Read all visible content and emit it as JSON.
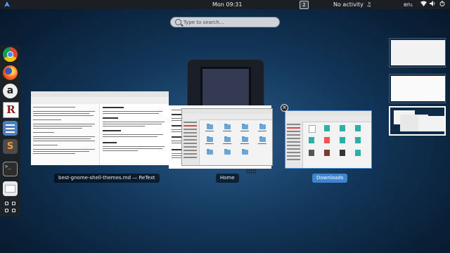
{
  "topbar": {
    "clock": "Mon 09:31",
    "workspace_indicator": "2",
    "activity": "No activity",
    "language": "en₁",
    "icons": [
      "activities-icon",
      "music-icon",
      "wifi-icon",
      "volume-icon",
      "power-icon"
    ]
  },
  "search": {
    "placeholder": "Type to search..."
  },
  "dash": {
    "apps": [
      "chrome-icon",
      "firefox-icon",
      "atom-icon",
      "retext-icon",
      "settings-icon",
      "sublime-text-icon",
      "terminal-icon",
      "files-icon",
      "app-grid-icon"
    ],
    "atom_glyph": "a",
    "retext_glyph": "R",
    "sublime_glyph": "S",
    "terminal_glyph": ">_"
  },
  "windows": [
    {
      "label": "best-gnome-shell-themes.md — ReText"
    },
    {
      "label": "Home"
    },
    {
      "label": "Downloads"
    }
  ],
  "close_glyph": "×",
  "colors": {
    "selected_label_bg": "#3d84d1",
    "topbar_bg": "#1b1f23"
  }
}
